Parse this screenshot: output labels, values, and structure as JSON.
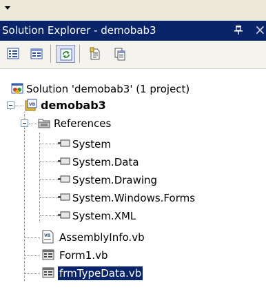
{
  "window": {
    "title": "Solution Explorer - demobab3",
    "pin_icon": "pushpin-icon",
    "close_glyph": "×"
  },
  "toolbar": {
    "buttons": [
      {
        "name": "properties-button",
        "icon": "properties-icon"
      },
      {
        "name": "show-all-files-button",
        "icon": "show-all-files-icon"
      },
      {
        "name": "refresh-button",
        "icon": "refresh-icon"
      },
      {
        "name": "view-code-button",
        "icon": "view-code-icon"
      },
      {
        "name": "view-designer-button",
        "icon": "view-designer-icon"
      }
    ]
  },
  "tree": {
    "solution": {
      "label": "Solution 'demobab3' (1 project)",
      "icon": "solution-icon"
    },
    "project": {
      "label": "demobab3",
      "icon": "vb-project-icon",
      "expanded": true
    },
    "references": {
      "label": "References",
      "icon": "references-folder-icon",
      "expanded": true,
      "items": [
        "System",
        "System.Data",
        "System.Drawing",
        "System.Windows.Forms",
        "System.XML"
      ]
    },
    "files": [
      {
        "label": "AssemblyInfo.vb",
        "icon": "vb-file-icon",
        "selected": false
      },
      {
        "label": "Form1.vb",
        "icon": "form-icon",
        "selected": false
      },
      {
        "label": "frmTypeData.vb",
        "icon": "form-icon",
        "selected": true
      }
    ]
  }
}
